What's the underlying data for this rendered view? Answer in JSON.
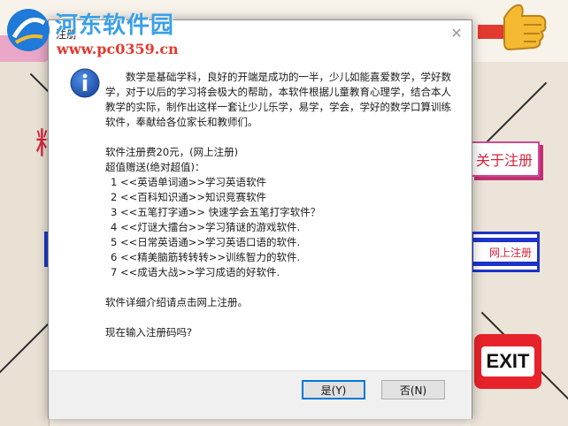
{
  "watermark": {
    "site_name": "河东软件园",
    "url": "www.pc0359.cn"
  },
  "background_app": {
    "about_register_label": "关于注册",
    "online_register_label": "网上注册",
    "exit_label": "EXIT",
    "left_red_char": "精"
  },
  "dialog": {
    "title": "注册",
    "close_symbol": "✕",
    "message": {
      "intro": "数学是基础学科，良好的开端是成功的一半，少儿如能喜爱数学，学好数学，对于以后的学习将会极大的帮助，本软件根据儿童教育心理学，结合本人教学的实际，制作出这样一套让少儿乐学，易学，学会，学好的数学口算训练软件，奉献给各位家长和教师们。",
      "price": "软件注册费20元，(网上注册)",
      "bonus_heading": "超值赠送(绝对超值)：",
      "gifts": [
        "1 <<英语单词通>>学习英语软件",
        "2 <<百科知识通>>知识竞赛软件",
        "3 <<五笔打字通>> 快速学会五笔打字软件？",
        "4 <<灯谜大擂台>>学习猜谜的游戏软件.",
        "5 <<日常英语通>>学习英语口语的软件.",
        "6 <<精美脑筋转转转>>训练智力的软件.",
        "7 <<成语大战>>学习成语的好软件."
      ],
      "details": "软件详细介绍请点击网上注册。",
      "question": "现在输入注册码吗?"
    },
    "buttons": {
      "yes": "是(Y)",
      "no": "否(N)"
    }
  },
  "colors": {
    "watermark_blue": "#3aa0e6",
    "watermark_red": "#e33a2f",
    "exit_red": "#e8222a",
    "accent_focus": "#0078d7"
  }
}
